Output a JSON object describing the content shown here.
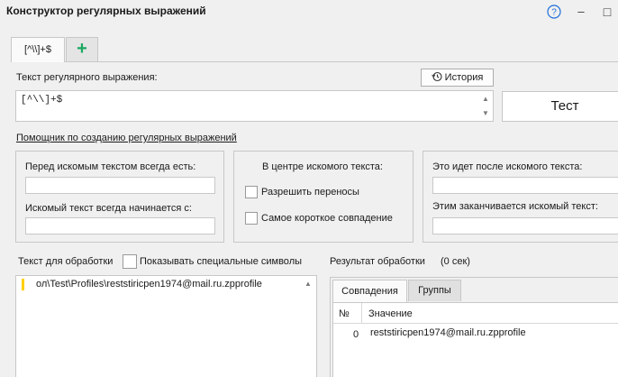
{
  "window": {
    "title": "Конструктор регулярных выражений",
    "help_icon": "?",
    "minimize_icon": "–",
    "maximize_icon": "□"
  },
  "tabs": {
    "active_label": "[^\\\\]+$",
    "add_icon": "+"
  },
  "regex": {
    "label": "Текст регулярного выражения:",
    "value": "[^\\\\]+$",
    "history_label": "История",
    "test_label": "Тест",
    "helper_link": "Помощник по созданию регулярных выражений"
  },
  "helper": {
    "before_label": "Перед искомым текстом всегда есть:",
    "starts_label": "Искомый текст всегда начинается с:",
    "center_label": "В центре искомого текста:",
    "allow_newlines_label": "Разрешить переносы",
    "shortest_match_label": "Самое короткое совпадение",
    "after_label": "Это идет после искомого текста:",
    "ends_label": "Этим заканчивается искомый текст:"
  },
  "source": {
    "label": "Текст для обработки",
    "show_special_label": "Показывать специальные символы",
    "text": "ол\\Test\\Profiles\\reststiricpen1974@mail.ru.zpprofile"
  },
  "result": {
    "label": "Результат обработки",
    "time": "(0 сек)",
    "tabs": [
      "Совпадения",
      "Группы"
    ],
    "columns": [
      "№",
      "Значение"
    ],
    "rows": [
      {
        "index": "0",
        "value": "reststiricpen1974@mail.ru.zpprofile"
      }
    ]
  },
  "colors": {
    "background": "#f0f0f0",
    "accent_green": "#1aa860",
    "help_blue": "#1e6fd9",
    "caret_yellow": "#ffd000"
  }
}
